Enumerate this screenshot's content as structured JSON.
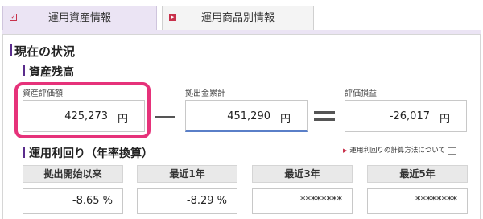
{
  "tabs": [
    {
      "label": "運用資産情報",
      "active": true
    },
    {
      "label": "運用商品別情報",
      "active": false
    }
  ],
  "section_title": "現在の状況",
  "balance": {
    "title": "資産残高",
    "asset_label": "資産評価額",
    "asset_value": "425,273",
    "contrib_label": "拠出金累計",
    "contrib_value": "451,290",
    "pl_label": "評価損益",
    "pl_value": "-26,017",
    "unit": "円"
  },
  "returns": {
    "title": "運用利回り（年率換算）",
    "link_label": "運用利回りの計算方法について",
    "periods": [
      {
        "label": "拠出開始以来",
        "value": "-8.65 %"
      },
      {
        "label": "最近1年",
        "value": "-8.29 %"
      },
      {
        "label": "最近3年",
        "value": "********"
      },
      {
        "label": "最近5年",
        "value": "********"
      }
    ]
  },
  "colors": {
    "accent": "#5a2c8c",
    "highlight": "#e6327a",
    "tab_active_bg": "#ebe4f4"
  }
}
